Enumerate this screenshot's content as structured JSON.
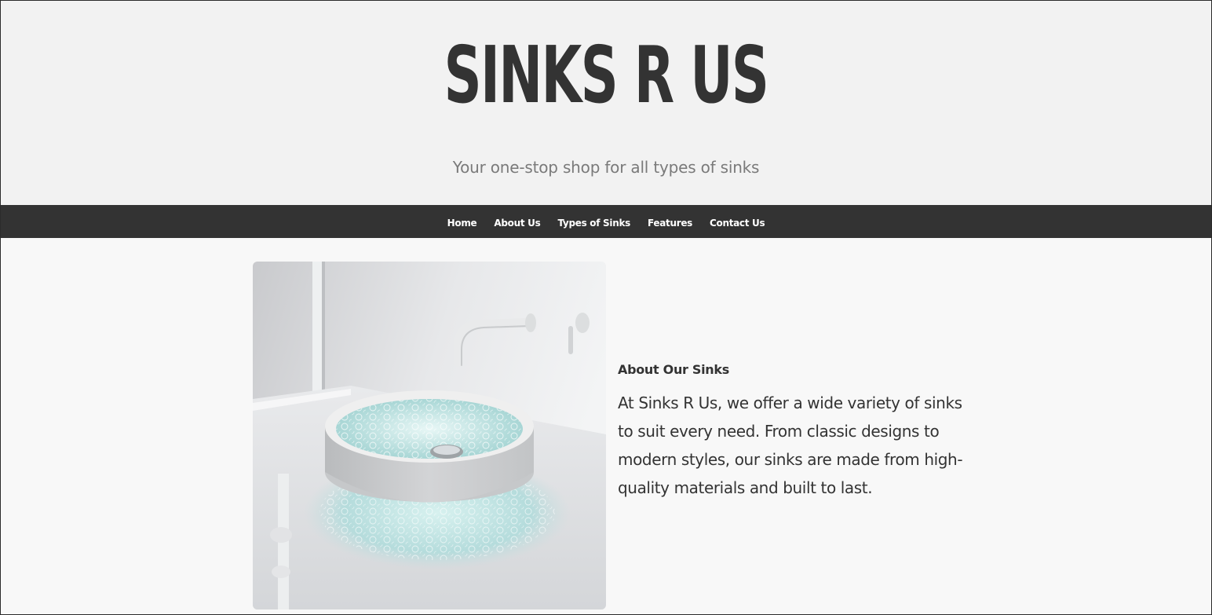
{
  "header": {
    "title": "SINKS R US",
    "tagline": "Your one-stop shop for all types of sinks"
  },
  "nav": {
    "items": [
      {
        "label": "Home"
      },
      {
        "label": "About Us"
      },
      {
        "label": "Types of Sinks"
      },
      {
        "label": "Features"
      },
      {
        "label": "Contact Us"
      }
    ]
  },
  "about": {
    "heading": "About Our Sinks",
    "body": "At Sinks R Us, we offer a wide variety of sinks to suit every need. From classic designs to modern styles, our sinks are made from high-quality materials and built to last."
  },
  "colors": {
    "header_bg": "#f2f2f2",
    "nav_bg": "#333333",
    "title_text": "#333333",
    "tagline_text": "#7a7a7a",
    "page_bg": "#f8f8f8"
  }
}
